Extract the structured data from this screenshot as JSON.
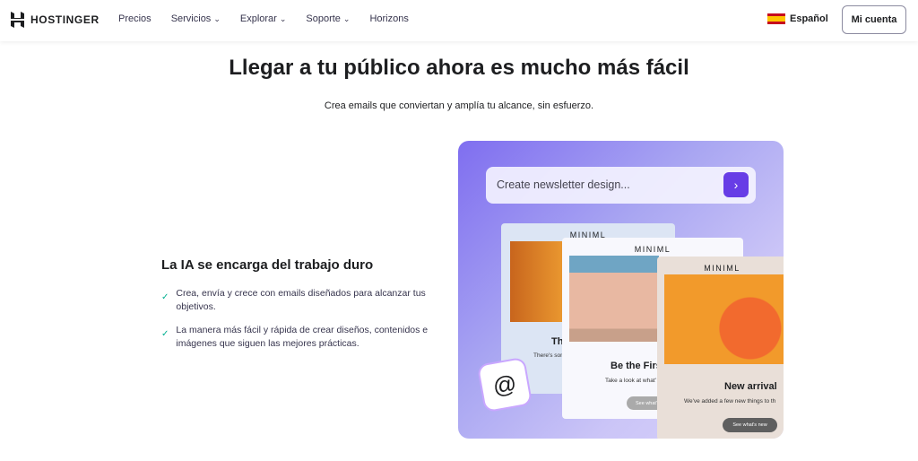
{
  "nav": {
    "brand": "HOSTINGER",
    "items": [
      {
        "label": "Precios",
        "dropdown": false
      },
      {
        "label": "Servicios",
        "dropdown": true
      },
      {
        "label": "Explorar",
        "dropdown": true
      },
      {
        "label": "Soporte",
        "dropdown": true
      },
      {
        "label": "Horizons",
        "dropdown": false
      }
    ],
    "language": "Español",
    "account": "Mi cuenta"
  },
  "main": {
    "title": "Llegar a tu público ahora es mucho más fácil",
    "subtitle": "Crea emails que conviertan y amplía tu alcance, sin esfuerzo.",
    "feature_title": "La IA se encarga del trabajo duro",
    "features": [
      "Crea, envía y crece con emails diseñados para alcanzar tus objetivos.",
      "La manera más fácil y rápida de crear diseños, contenidos e imágenes que siguen las mejores prácticas."
    ]
  },
  "hero": {
    "prompt": "Create newsletter design...",
    "cards": [
      {
        "brand": "MINIML",
        "title": "Th",
        "text": "There's somethin"
      },
      {
        "brand": "MINIML",
        "title": "Be the Firs",
        "text": "Take a look at what'",
        "button": "See what'"
      },
      {
        "brand": "MINIML",
        "title": "New arrival",
        "text": "We've added a few new things to th",
        "button": "See what's new"
      }
    ]
  }
}
